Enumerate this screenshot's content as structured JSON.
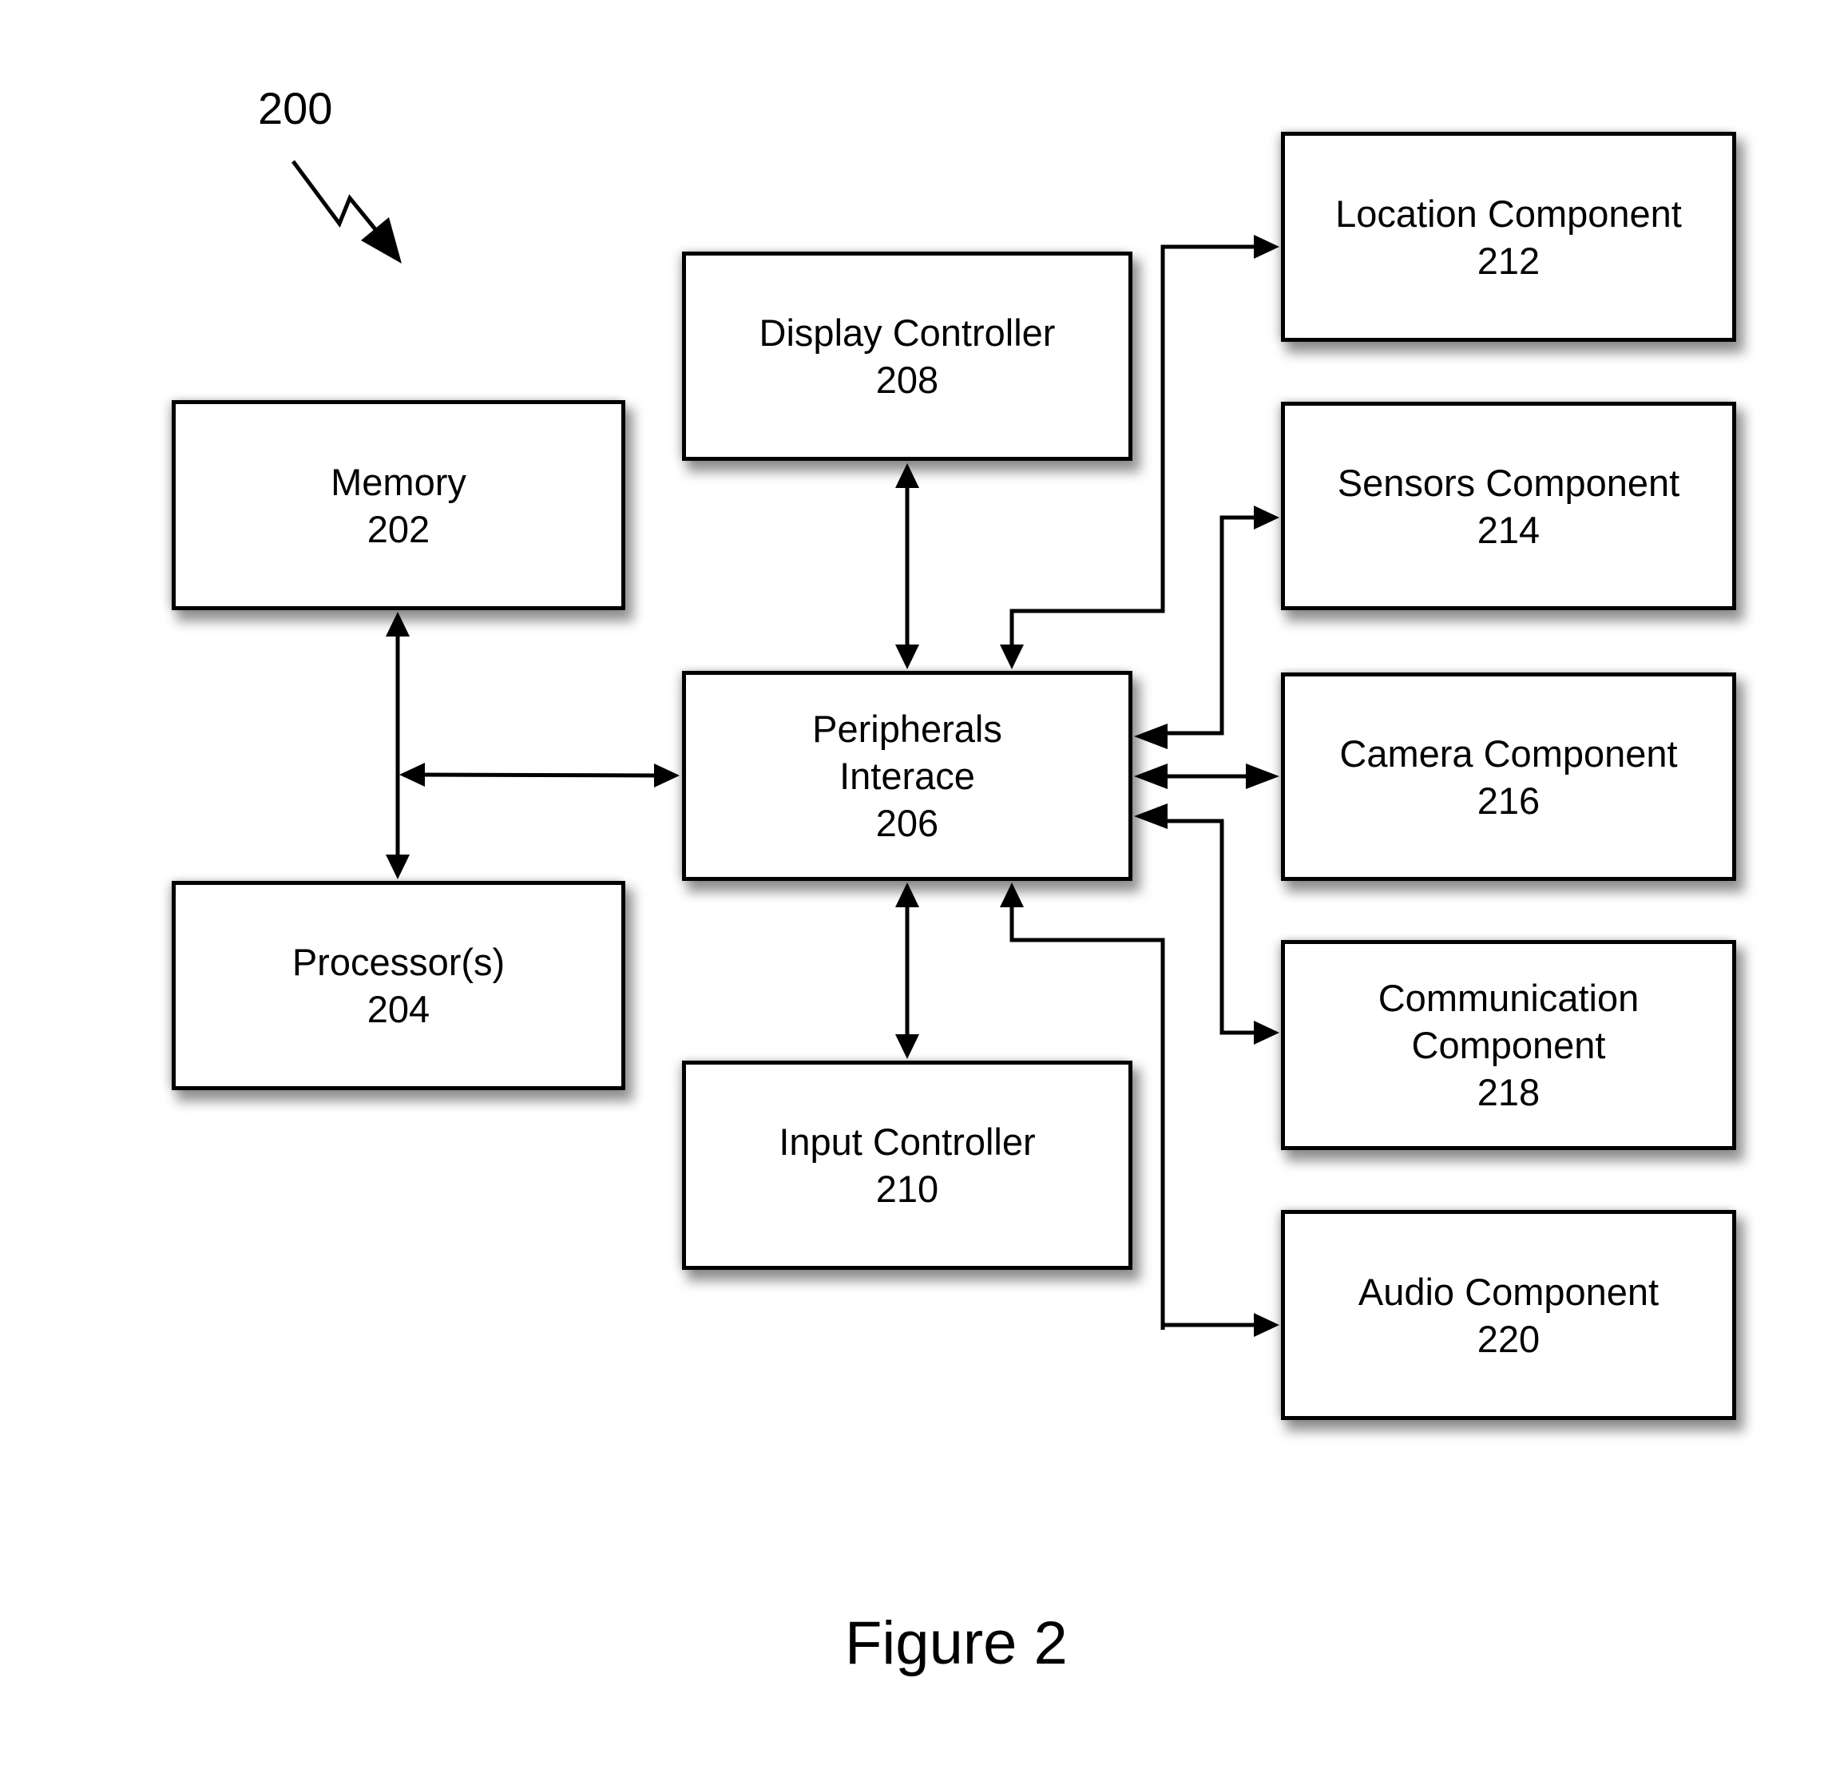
{
  "figure": {
    "reference_numeral": "200",
    "caption": "Figure 2"
  },
  "blocks": {
    "memory": {
      "lines": [
        "Memory"
      ],
      "number": "202"
    },
    "processor": {
      "lines": [
        "Processor(s)"
      ],
      "number": "204"
    },
    "peripherals": {
      "lines": [
        "Peripherals",
        "Interace"
      ],
      "number": "206"
    },
    "display": {
      "lines": [
        "Display Controller"
      ],
      "number": "208"
    },
    "input": {
      "lines": [
        "Input Controller"
      ],
      "number": "210"
    },
    "location": {
      "lines": [
        "Location Component"
      ],
      "number": "212"
    },
    "sensors": {
      "lines": [
        "Sensors Component"
      ],
      "number": "214"
    },
    "camera": {
      "lines": [
        "Camera Component"
      ],
      "number": "216"
    },
    "comm": {
      "lines": [
        "Communication",
        "Component"
      ],
      "number": "218"
    },
    "audio": {
      "lines": [
        "Audio Component"
      ],
      "number": "220"
    }
  },
  "connections": [
    {
      "from": "memory",
      "to": "processor",
      "direction": "bidirectional"
    },
    {
      "from": "memory-processor-bus",
      "to": "peripherals",
      "direction": "bidirectional"
    },
    {
      "from": "display",
      "to": "peripherals",
      "direction": "bidirectional"
    },
    {
      "from": "peripherals",
      "to": "input",
      "direction": "bidirectional"
    },
    {
      "from": "location",
      "to": "peripherals",
      "direction": "bidirectional"
    },
    {
      "from": "audio",
      "to": "peripherals",
      "direction": "bidirectional"
    },
    {
      "from": "sensors",
      "to": "peripherals",
      "direction": "bidirectional"
    },
    {
      "from": "camera",
      "to": "peripherals",
      "direction": "bidirectional"
    },
    {
      "from": "comm",
      "to": "peripherals",
      "direction": "bidirectional"
    }
  ]
}
